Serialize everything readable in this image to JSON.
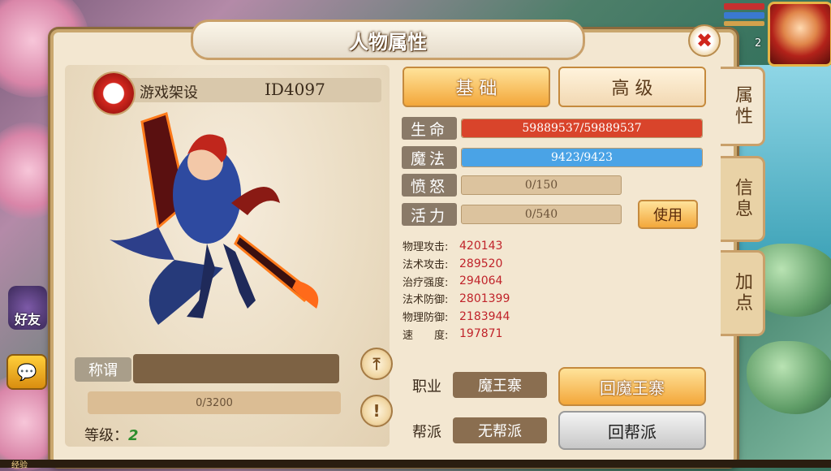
{
  "window": {
    "title": "人物属性"
  },
  "character": {
    "name": "游戏架设",
    "id": "ID4097",
    "title_label": "称谓",
    "title_value": "",
    "exp_text": "0/3200",
    "level_label": "等级：",
    "level_value": "2"
  },
  "tabs": {
    "basic": "基 础",
    "advanced": "高 级"
  },
  "side_tabs": [
    "属性",
    "信息",
    "加点"
  ],
  "stats": [
    {
      "label": "生命",
      "value": "59889537/59889537",
      "fill": 1.0,
      "color": "#d9442b"
    },
    {
      "label": "魔法",
      "value": "9423/9423",
      "fill": 1.0,
      "color": "#4aa3e6"
    },
    {
      "label": "愤怒",
      "value": "0/150",
      "fill": 0.0,
      "color": "#dcc39e"
    },
    {
      "label": "活力",
      "value": "0/540",
      "fill": 0.0,
      "color": "#dcc39e"
    }
  ],
  "use_button": "使用",
  "attributes": [
    {
      "name": "物理攻击:",
      "value": "420143"
    },
    {
      "name": "法术攻击:",
      "value": "289520"
    },
    {
      "name": "治疗强度:",
      "value": "294064"
    },
    {
      "name": "法术防御:",
      "value": "2801399"
    },
    {
      "name": "物理防御:",
      "value": "2183944"
    },
    {
      "name": "速　　度:",
      "value": "197871"
    }
  ],
  "profession": {
    "label": "职业",
    "value": "魔王寨",
    "button": "回魔王寨"
  },
  "guild": {
    "label": "帮派",
    "value": "无帮派",
    "button": "回帮派"
  },
  "hud": {
    "portrait_level": "2",
    "friends": "好友",
    "exp_strip": "经验"
  },
  "icons": {
    "close": "close-icon",
    "upload": "upload-icon",
    "info": "exclamation-icon",
    "chat": "chat-icon"
  }
}
